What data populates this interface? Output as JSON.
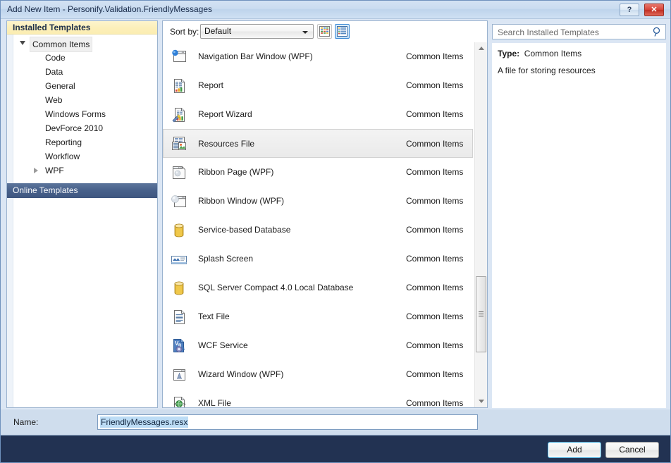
{
  "window": {
    "title": "Add New Item - Personify.Validation.FriendlyMessages",
    "help_label": "?",
    "close_label": "✕"
  },
  "sidebar": {
    "installed_header": "Installed Templates",
    "online_header": "Online Templates",
    "tree": [
      {
        "label": "Common Items",
        "level": 0,
        "expanded": true,
        "selected": true
      },
      {
        "label": "Code",
        "level": 1,
        "expanded": null,
        "selected": false
      },
      {
        "label": "Data",
        "level": 1,
        "expanded": null,
        "selected": false
      },
      {
        "label": "General",
        "level": 1,
        "expanded": null,
        "selected": false
      },
      {
        "label": "Web",
        "level": 1,
        "expanded": null,
        "selected": false
      },
      {
        "label": "Windows Forms",
        "level": 1,
        "expanded": null,
        "selected": false
      },
      {
        "label": "DevForce 2010",
        "level": 1,
        "expanded": null,
        "selected": false
      },
      {
        "label": "Reporting",
        "level": 1,
        "expanded": null,
        "selected": false
      },
      {
        "label": "Workflow",
        "level": 1,
        "expanded": null,
        "selected": false
      },
      {
        "label": "WPF",
        "level": 1,
        "expanded": false,
        "selected": false
      }
    ]
  },
  "toolbar": {
    "sort_by_label": "Sort by:",
    "sort_value": "Default",
    "sort_options": [
      "Default"
    ],
    "view_grid_icon": "grid-view-icon",
    "view_list_icon": "list-view-icon",
    "view_selected": "list"
  },
  "search": {
    "placeholder": "Search Installed Templates",
    "value": "",
    "icon": "search-icon"
  },
  "items": [
    {
      "name": "Navigation Bar Window (WPF)",
      "category": "Common Items",
      "icon": "window-nav-icon",
      "selected": false
    },
    {
      "name": "Report",
      "category": "Common Items",
      "icon": "report-icon",
      "selected": false
    },
    {
      "name": "Report Wizard",
      "category": "Common Items",
      "icon": "report-wizard-icon",
      "selected": false
    },
    {
      "name": "Resources File",
      "category": "Common Items",
      "icon": "resources-file-icon",
      "selected": true
    },
    {
      "name": "Ribbon Page (WPF)",
      "category": "Common Items",
      "icon": "ribbon-page-icon",
      "selected": false
    },
    {
      "name": "Ribbon Window (WPF)",
      "category": "Common Items",
      "icon": "ribbon-window-icon",
      "selected": false
    },
    {
      "name": "Service-based Database",
      "category": "Common Items",
      "icon": "database-icon",
      "selected": false
    },
    {
      "name": "Splash Screen",
      "category": "Common Items",
      "icon": "splash-screen-icon",
      "selected": false
    },
    {
      "name": "SQL Server Compact 4.0 Local Database",
      "category": "Common Items",
      "icon": "database-icon",
      "selected": false
    },
    {
      "name": "Text File",
      "category": "Common Items",
      "icon": "text-file-icon",
      "selected": false
    },
    {
      "name": "WCF Service",
      "category": "Common Items",
      "icon": "wcf-service-icon",
      "selected": false
    },
    {
      "name": "Wizard Window (WPF)",
      "category": "Common Items",
      "icon": "wizard-window-icon",
      "selected": false
    },
    {
      "name": "XML File",
      "category": "Common Items",
      "icon": "xml-file-icon",
      "selected": false
    }
  ],
  "details": {
    "type_label": "Type:",
    "type_value": "Common Items",
    "description": "A file for storing resources"
  },
  "name_field": {
    "label": "Name:",
    "value": "FriendlyMessages.resx",
    "selected": true
  },
  "buttons": {
    "add": "Add",
    "cancel": "Cancel"
  },
  "colors": {
    "title_bar": "#cadcf0",
    "dialog_bg": "#dbe6f4",
    "installed_header_bg": "#fcefb9",
    "online_header_bg": "#47608a",
    "bottom_bar": "#223252",
    "selection": "#bcdcf5",
    "accent": "#3aa6d8",
    "close_button": "#d6453a"
  }
}
